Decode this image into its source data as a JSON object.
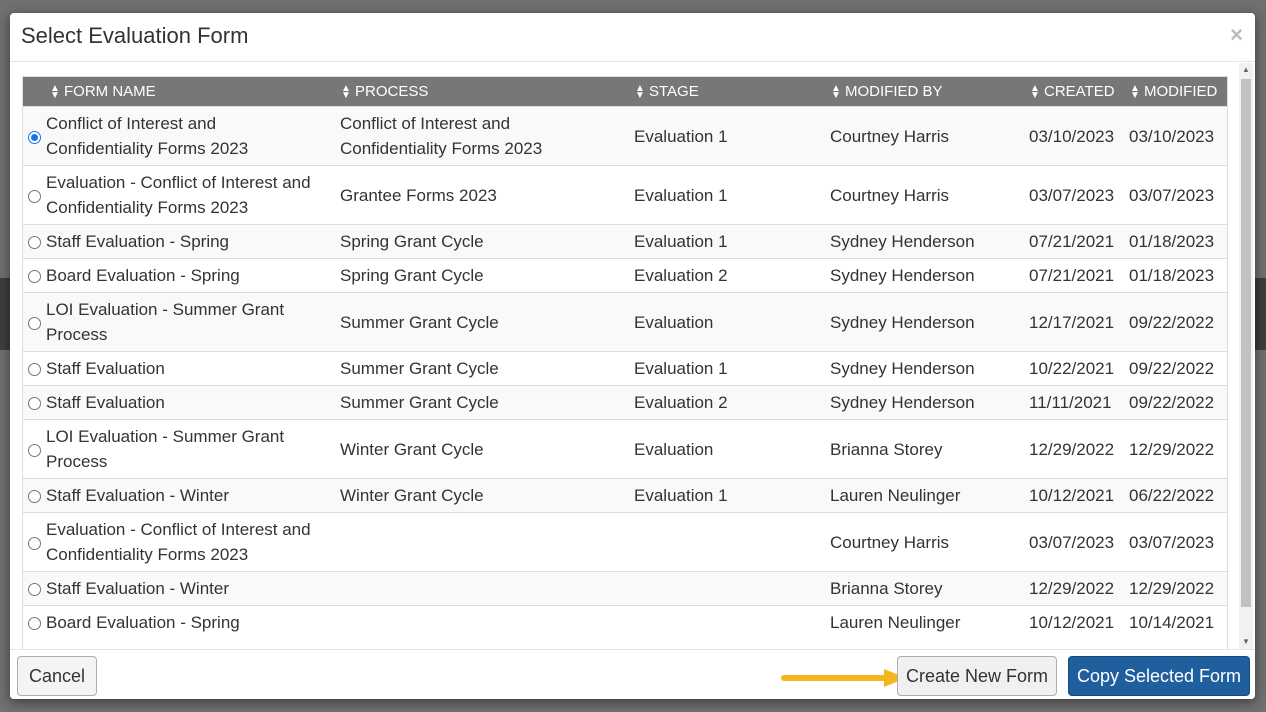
{
  "modal": {
    "title": "Select Evaluation Form",
    "close": "×"
  },
  "columns": {
    "form_name": "FORM NAME",
    "process": "PROCESS",
    "stage": "STAGE",
    "modified_by": "MODIFIED BY",
    "created": "CREATED",
    "modified": "MODIFIED"
  },
  "rows": [
    {
      "selected": true,
      "form_name": "Conflict of Interest and Confidentiality Forms 2023",
      "process": "Conflict of Interest and Confidentiality Forms 2023",
      "stage": "Evaluation 1",
      "modified_by": "Courtney Harris",
      "created": "03/10/2023",
      "modified": "03/10/2023"
    },
    {
      "selected": false,
      "form_name": "Evaluation - Conflict of Interest and Confidentiality Forms 2023",
      "process": "Grantee Forms 2023",
      "stage": "Evaluation 1",
      "modified_by": "Courtney Harris",
      "created": "03/07/2023",
      "modified": "03/07/2023"
    },
    {
      "selected": false,
      "form_name": "Staff Evaluation - Spring",
      "process": "Spring Grant Cycle",
      "stage": "Evaluation 1",
      "modified_by": "Sydney Henderson",
      "created": "07/21/2021",
      "modified": "01/18/2023"
    },
    {
      "selected": false,
      "form_name": "Board Evaluation - Spring",
      "process": "Spring Grant Cycle",
      "stage": "Evaluation 2",
      "modified_by": "Sydney Henderson",
      "created": "07/21/2021",
      "modified": "01/18/2023"
    },
    {
      "selected": false,
      "form_name": "LOI Evaluation - Summer Grant Process",
      "process": "Summer Grant Cycle",
      "stage": "Evaluation",
      "modified_by": "Sydney Henderson",
      "created": "12/17/2021",
      "modified": "09/22/2022"
    },
    {
      "selected": false,
      "form_name": "Staff Evaluation",
      "process": "Summer Grant Cycle",
      "stage": "Evaluation 1",
      "modified_by": "Sydney Henderson",
      "created": "10/22/2021",
      "modified": "09/22/2022"
    },
    {
      "selected": false,
      "form_name": "Staff Evaluation",
      "process": "Summer Grant Cycle",
      "stage": "Evaluation 2",
      "modified_by": "Sydney Henderson",
      "created": "11/11/2021",
      "modified": "09/22/2022"
    },
    {
      "selected": false,
      "form_name": "LOI Evaluation - Summer Grant Process",
      "process": "Winter Grant Cycle",
      "stage": "Evaluation",
      "modified_by": "Brianna Storey",
      "created": "12/29/2022",
      "modified": "12/29/2022"
    },
    {
      "selected": false,
      "form_name": "Staff Evaluation - Winter",
      "process": "Winter Grant Cycle",
      "stage": "Evaluation 1",
      "modified_by": "Lauren Neulinger",
      "created": "10/12/2021",
      "modified": "06/22/2022"
    },
    {
      "selected": false,
      "form_name": "Evaluation - Conflict of Interest and Confidentiality Forms 2023",
      "process": "",
      "stage": "",
      "modified_by": "Courtney Harris",
      "created": "03/07/2023",
      "modified": "03/07/2023"
    },
    {
      "selected": false,
      "form_name": "Staff Evaluation - Winter",
      "process": "",
      "stage": "",
      "modified_by": "Brianna Storey",
      "created": "12/29/2022",
      "modified": "12/29/2022"
    },
    {
      "selected": false,
      "form_name": "Board Evaluation - Spring",
      "process": "",
      "stage": "",
      "modified_by": "Lauren Neulinger",
      "created": "10/12/2021",
      "modified": "10/14/2021"
    }
  ],
  "footer": {
    "cancel": "Cancel",
    "create": "Create New Form",
    "copy": "Copy Selected Form"
  },
  "colors": {
    "header_bg": "#777777",
    "primary_button": "#1f5f9e",
    "arrow": "#f5b51c",
    "radio_selected": "#1a73e8"
  }
}
